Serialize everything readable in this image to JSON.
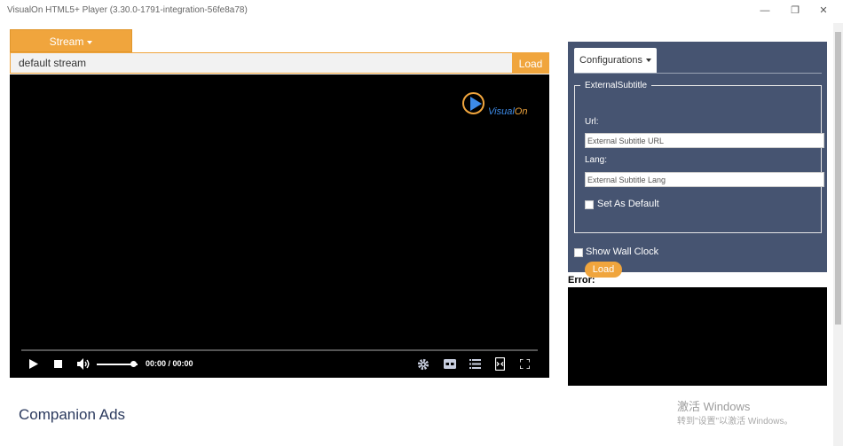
{
  "window": {
    "title": "VisualOn HTML5+ Player (3.30.0-1791-integration-56fe8a78)",
    "minimize_glyph": "—",
    "maximize_glyph": "❐",
    "close_glyph": "✕"
  },
  "stream": {
    "dropdown_label": "Stream",
    "url_value": "default stream",
    "load_label": "Load"
  },
  "player": {
    "logo_word_a": "Visual",
    "logo_word_b": "On",
    "time": "00:00 / 00:00",
    "playback_progress": 0,
    "volume_level": 0.9
  },
  "config": {
    "tab_label": "Configurations",
    "external_subtitle": {
      "legend": "ExternalSubtitle",
      "url_label": "Url:",
      "url_placeholder": "External Subtitle URL",
      "lang_label": "Lang:",
      "lang_placeholder": "External Subtitle Lang",
      "default_label": "Set As Default",
      "load_label": "Load"
    },
    "wall_clock_label": "Show Wall Clock"
  },
  "error": {
    "label": "Error:"
  },
  "companion": {
    "title": "Companion Ads"
  },
  "watermark": {
    "line1": "激活 Windows",
    "line2": "转到\"设置\"以激活 Windows。"
  },
  "colors": {
    "accent": "#f0a53d",
    "panel": "#465471",
    "logo_blue": "#3d8be8"
  }
}
